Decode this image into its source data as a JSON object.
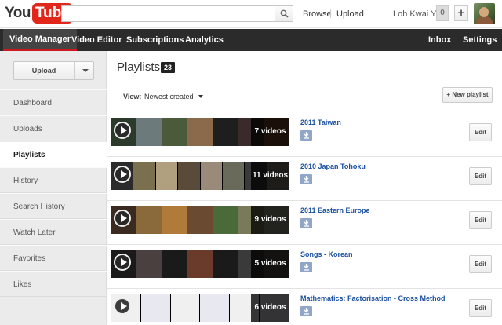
{
  "masthead": {
    "logo_you": "You",
    "logo_tube": "Tube",
    "search_value": "",
    "browse_label": "Browse",
    "upload_label": "Upload",
    "username": "Loh Kwai Yin",
    "notification_count": "0",
    "add_label": "+"
  },
  "nav": {
    "video_manager": "Video Manager",
    "video_editor": "Video Editor",
    "subscriptions": "Subscriptions",
    "analytics": "Analytics",
    "inbox": "Inbox",
    "settings": "Settings"
  },
  "sidebar": {
    "upload_label": "Upload",
    "items": [
      {
        "label": "Dashboard",
        "active": false
      },
      {
        "label": "Uploads",
        "active": false
      },
      {
        "label": "Playlists",
        "active": true
      },
      {
        "label": "History",
        "active": false
      },
      {
        "label": "Search History",
        "active": false
      },
      {
        "label": "Watch Later",
        "active": false
      },
      {
        "label": "Favorites",
        "active": false
      },
      {
        "label": "Likes",
        "active": false
      }
    ]
  },
  "main": {
    "title": "Playlists",
    "count": "23",
    "view_label": "View:",
    "sort_value": "Newest created",
    "new_playlist_label": "+ New playlist",
    "playlists": [
      {
        "title": "2011 Taiwan",
        "videos": "7 videos",
        "edit_label": "Edit",
        "frame_colors": [
          "#2b3a2a",
          "#6d7a7c",
          "#4a5a3a",
          "#8a6a4a",
          "#1e1e1e",
          "#3a2a2a",
          "#7a4a2a"
        ]
      },
      {
        "title": "2010 Japan Tohoku",
        "videos": "11 videos",
        "edit_label": "Edit",
        "frame_colors": [
          "#2a2a2a",
          "#7a7050",
          "#b0a080",
          "#5a4a3a",
          "#9a8a7a",
          "#6a6a5a",
          "#3a3a3a",
          "#8a8070"
        ]
      },
      {
        "title": "2011 Eastern Europe",
        "videos": "9 videos",
        "edit_label": "Edit",
        "frame_colors": [
          "#3a2a20",
          "#8a6a3a",
          "#b07a3a",
          "#6a4a30",
          "#4a6a3a",
          "#7a7a5a",
          "#9a9a8a"
        ]
      },
      {
        "title": "Songs - Korean",
        "videos": "5 videos",
        "edit_label": "Edit",
        "frame_colors": [
          "#1a1a1a",
          "#4a4040",
          "#1a1a1a",
          "#6a3a2a",
          "#1a1a1a",
          "#3a3a3a",
          "#5a5050"
        ]
      },
      {
        "title": "Mathematics: Factorisation - Cross Method",
        "videos": "6 videos",
        "edit_label": "Edit",
        "frame_colors": [
          "#f0f0f0",
          "#e8e8f0",
          "#f0f0f0",
          "#e8e8f0",
          "#f0f0f0",
          "#e8e8f0"
        ]
      }
    ]
  },
  "colors": {
    "brand_red": "#e1261c",
    "nav_bg": "#2b2b2b",
    "link_blue": "#1b4fa0"
  }
}
